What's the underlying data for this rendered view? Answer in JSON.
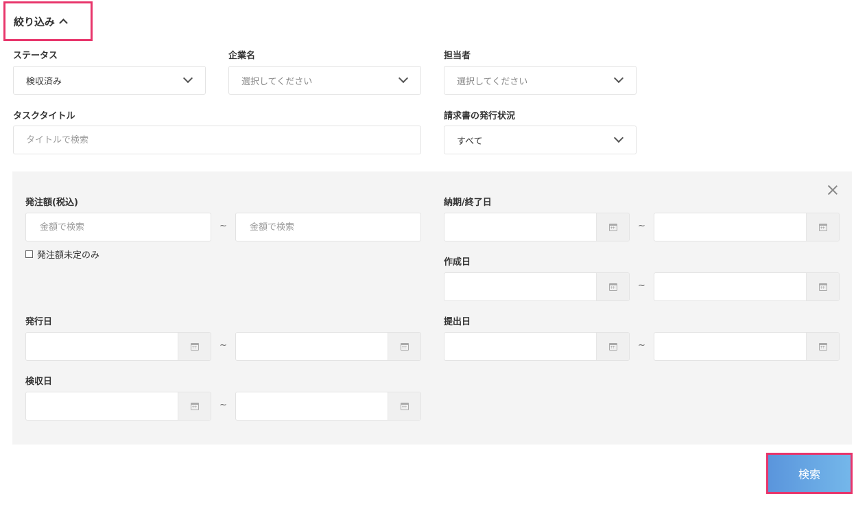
{
  "filter": {
    "toggle_label": "絞り込み"
  },
  "fields": {
    "status": {
      "label": "ステータス",
      "value": "検収済み"
    },
    "company": {
      "label": "企業名",
      "value": "選択してください"
    },
    "assignee": {
      "label": "担当者",
      "value": "選択してください"
    },
    "task_title": {
      "label": "タスクタイトル",
      "placeholder": "タイトルで検索"
    },
    "invoice_status": {
      "label": "請求書の発行状況",
      "value": "すべて"
    }
  },
  "advanced": {
    "order_amount": {
      "label": "発注額(税込)",
      "min_placeholder": "金額で検索",
      "max_placeholder": "金額で検索",
      "separator": "~",
      "undecided_only_label": "発注額未定のみ"
    },
    "due_date": {
      "label": "納期/終了日",
      "separator": "~"
    },
    "created_date": {
      "label": "作成日",
      "separator": "~"
    },
    "issued_date": {
      "label": "発行日",
      "separator": "~"
    },
    "submitted_date": {
      "label": "提出日",
      "separator": "~"
    },
    "accepted_date": {
      "label": "検収日",
      "separator": "~"
    }
  },
  "actions": {
    "search_label": "検索"
  },
  "colors": {
    "highlight": "#e8356b",
    "button_start": "#5a95dc",
    "button_end": "#74b7ea",
    "panel_bg": "#f4f4f4"
  }
}
